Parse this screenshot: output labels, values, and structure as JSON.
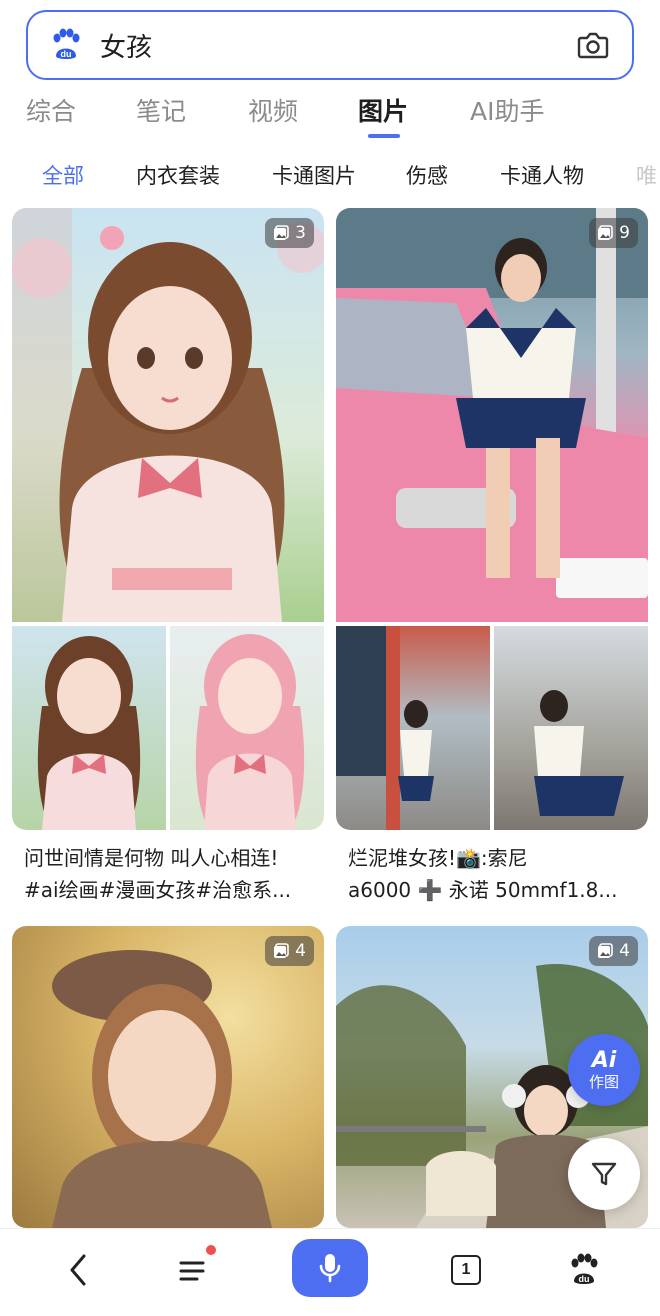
{
  "search": {
    "query": "女孩",
    "logo_icon": "baidu-paw-icon",
    "camera_icon": "camera-icon"
  },
  "main_tabs": [
    {
      "label": "综合"
    },
    {
      "label": "笔记"
    },
    {
      "label": "视频"
    },
    {
      "label": "图片",
      "active": true
    },
    {
      "label": "AI助手"
    }
  ],
  "sub_tabs": [
    {
      "label": "全部",
      "active": true
    },
    {
      "label": "内衣套装"
    },
    {
      "label": "卡通图片"
    },
    {
      "label": "伤感"
    },
    {
      "label": "卡通人物"
    },
    {
      "label": "唯"
    }
  ],
  "cards": [
    {
      "count": "3",
      "caption_line1": "问世间情是何物 叫人心相连!",
      "caption_line2": "#ai绘画#漫画女孩#治愈系..."
    },
    {
      "count": "9",
      "caption_line1": "烂泥堆女孩!📸:索尼",
      "caption_line2": "a6000 ➕ 永诺 50mmf1.8..."
    },
    {
      "count": "4"
    },
    {
      "count": "4"
    }
  ],
  "float": {
    "ai_label_top": "Ai",
    "ai_label_bottom": "作图",
    "filter_icon": "filter-icon"
  },
  "bottom_nav": {
    "back_icon": "back-icon",
    "menu_icon": "menu-icon",
    "mic_icon": "microphone-icon",
    "tabs_count": "1",
    "home_icon": "baidu-paw-icon"
  },
  "colors": {
    "accent": "#4e6ef2",
    "notify_dot": "#f24e4e"
  }
}
